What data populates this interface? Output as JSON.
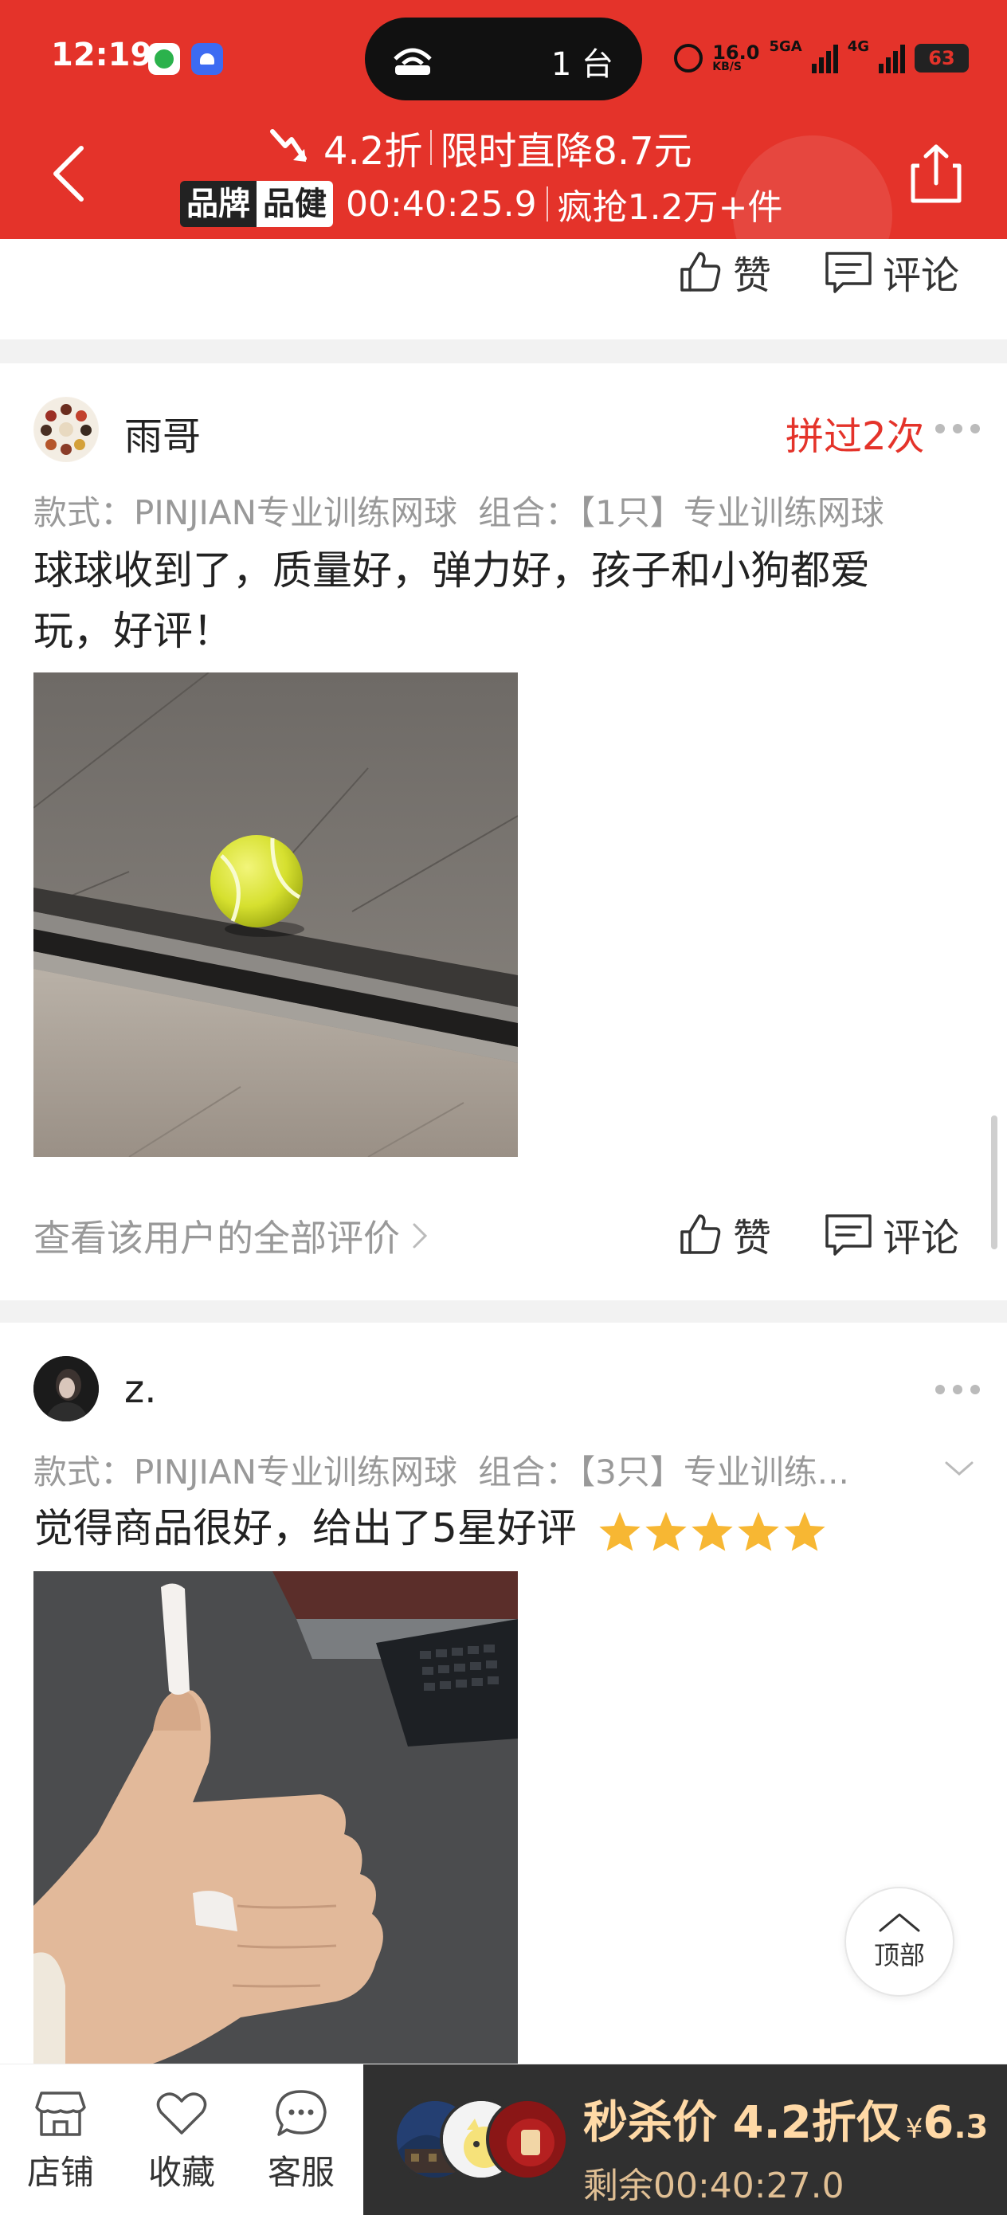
{
  "status_bar": {
    "time": "12:19",
    "pill_label": "1 台",
    "speed_value": "16.0",
    "speed_unit": "KB/S",
    "net1": "5GA",
    "net2": "4G",
    "battery": "63"
  },
  "header": {
    "discount": "4.2折",
    "price_drop": "限时直降8.7元",
    "brand_tag_1": "品牌",
    "brand_tag_2": "品健",
    "countdown": "00:40:25.9",
    "sold": "疯抢1.2万+件"
  },
  "actions": {
    "like": "赞",
    "comment": "评论"
  },
  "reviews": [
    {
      "username": "雨哥",
      "badge": "拼过2次",
      "spec_style": "款式：PINJIAN专业训练网球",
      "spec_combo": "组合：【1只】专业训练网球",
      "text_line1": "球球收到了，质量好，弹力好，孩子和小狗都爱",
      "text_line2": "玩，好评！",
      "view_all": "查看该用户的全部评价"
    },
    {
      "username": "z.",
      "spec_style": "款式：PINJIAN专业训练网球",
      "spec_combo": "组合：【3只】专业训练...",
      "text": "觉得商品很好，给出了5星好评",
      "rating": 5
    }
  ],
  "back_to_top": "顶部",
  "bottom_nav": {
    "shop": "店铺",
    "favorite": "收藏",
    "service": "客服"
  },
  "seckill": {
    "label": "秒杀价 4.2折仅",
    "currency": "¥",
    "price_int": "6",
    "price_dec": ".3",
    "remaining": "剩余00:40:27.0"
  },
  "colors": {
    "brand_red": "#e4332a",
    "seckill_bg": "#303030",
    "seckill_text": "#ffd9a6",
    "star": "#f7b733"
  }
}
